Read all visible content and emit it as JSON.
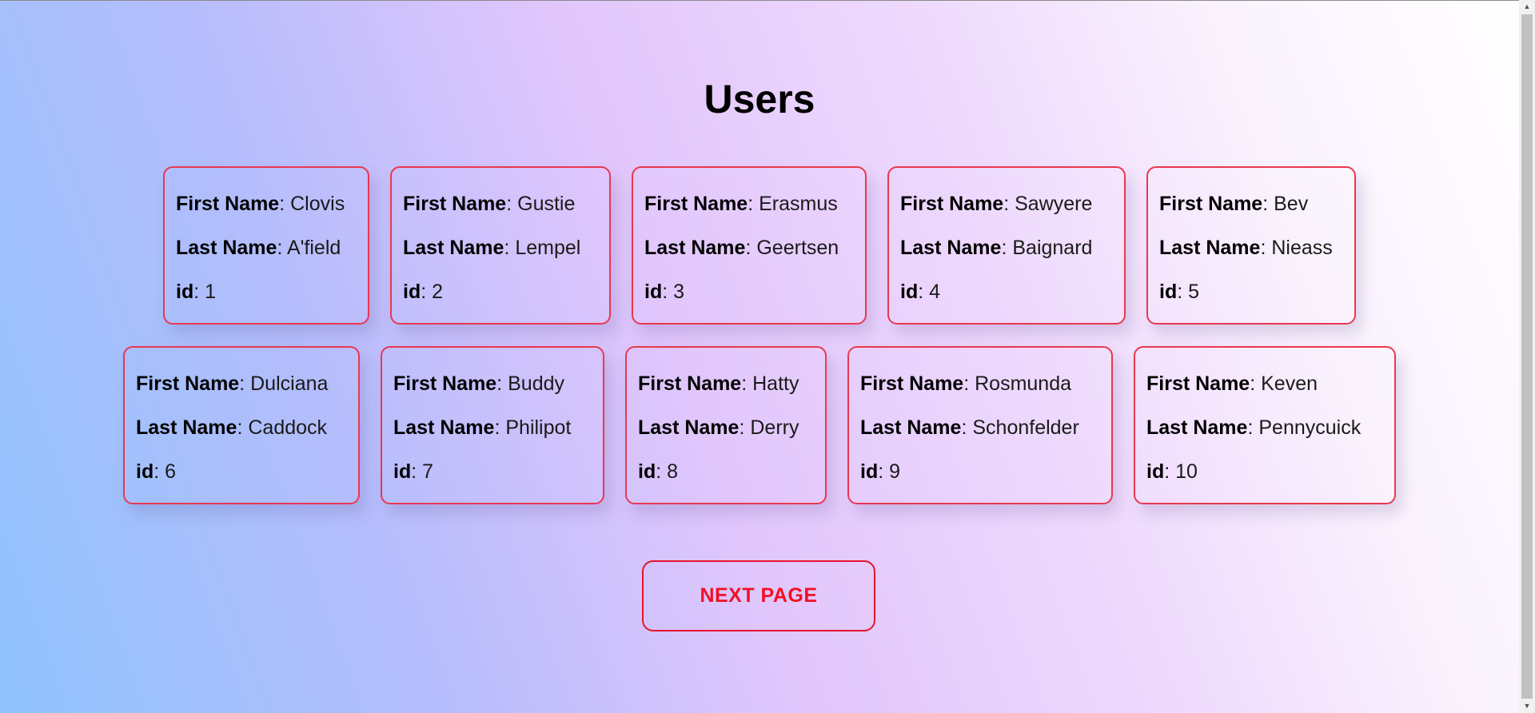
{
  "page": {
    "title": "Users",
    "next_button_label": "NEXT PAGE"
  },
  "labels": {
    "first_name": "First Name",
    "last_name": "Last Name",
    "id": "id",
    "separator": ": "
  },
  "users": [
    {
      "first_name": "Clovis",
      "last_name": "A'field",
      "id": "1"
    },
    {
      "first_name": "Gustie",
      "last_name": "Lempel",
      "id": "2"
    },
    {
      "first_name": "Erasmus",
      "last_name": "Geertsen",
      "id": "3"
    },
    {
      "first_name": "Sawyere",
      "last_name": "Baignard",
      "id": "4"
    },
    {
      "first_name": "Bev",
      "last_name": "Nieass",
      "id": "5"
    },
    {
      "first_name": "Dulciana",
      "last_name": "Caddock",
      "id": "6"
    },
    {
      "first_name": "Buddy",
      "last_name": "Philipot",
      "id": "7"
    },
    {
      "first_name": "Hatty",
      "last_name": "Derry",
      "id": "8"
    },
    {
      "first_name": "Rosmunda",
      "last_name": "Schonfelder",
      "id": "9"
    },
    {
      "first_name": "Keven",
      "last_name": "Pennycuick",
      "id": "10"
    }
  ],
  "colors": {
    "card_border": "#e8384f",
    "button_text": "#f21026",
    "button_border": "#e8132e"
  },
  "icons": {
    "scroll_up": "scroll-up-arrow-icon",
    "scroll_down": "scroll-down-arrow-icon"
  }
}
